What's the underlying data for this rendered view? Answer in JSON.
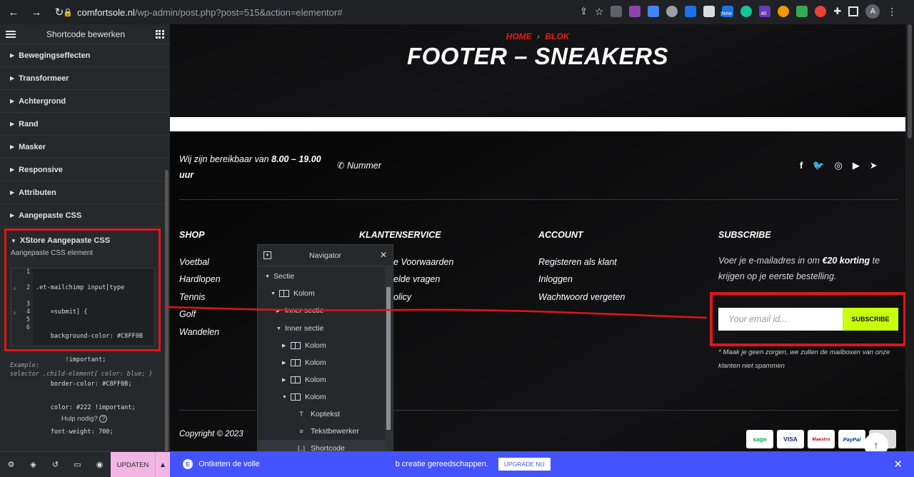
{
  "browser": {
    "host": "comfortsole.nl",
    "path": "/wp-admin/post.php?post=515&action=elementor#",
    "avatar_letter": "A",
    "ext_badges": [
      "New",
      "40"
    ]
  },
  "panel": {
    "title": "Shortcode bewerken",
    "sections": [
      "Bewegingseffecten",
      "Transformeer",
      "Achtergrond",
      "Rand",
      "Masker",
      "Responsive",
      "Attributen",
      "Aangepaste CSS"
    ],
    "xstore_title": "XStore Aangepaste CSS",
    "css_label": "Aangepaste CSS element",
    "code_lines": [
      ".et-mailchimp input[type",
      "    =submit] {",
      "    background-color: #C8FF0B",
      "        !important;",
      "    border-color: #C8FF0B;",
      "    color: #222 !important;",
      "    font-weight: 700;",
      "}"
    ],
    "line_numbers": [
      "1",
      "2",
      "",
      "3",
      "4",
      "5",
      "6"
    ],
    "example_1": "Example:",
    "example_2": "selector .child-element{ color: blue; }",
    "help": "Hulp nodig?",
    "update_label": "UPDATEN"
  },
  "site": {
    "crumb_home": "HOME",
    "crumb_sep": "›",
    "crumb_blog": "BLOK",
    "page_title": "FOOTER – SNEAKERS",
    "hours_prefix": "Wij zijn bereikbaar van",
    "hours_bold": "8.00 – 19.00 uur",
    "phone": "Nummer",
    "shop_head": "SHOP",
    "shop_links": [
      "Voetbal",
      "Hardlopen",
      "Tennis",
      "Golf",
      "Wandelen"
    ],
    "service_head": "KLANTENSERVICE",
    "service_links": [
      "e Voorwaarden",
      "elde vragen",
      "olicy"
    ],
    "account_head": "ACCOUNT",
    "account_links": [
      "Registeren als klant",
      "Inloggen",
      "Wachtwoord vergeten"
    ],
    "subscribe_head": "SUBSCRIBE",
    "subscribe_text_1": "Voer je e-mailadres in om",
    "subscribe_bold": "€20 korting",
    "subscribe_text_2": "te krijgen op je eerste bestelling.",
    "email_placeholder": "Your email id...",
    "subscribe_button": "SUBSCRIBE",
    "subscribe_note": "* Maak je geen zorgen, we zullen de mailboxen van onze klanten niet spammen",
    "copyright": "Copyright © 2023",
    "payments": [
      "sage",
      "VISA",
      "Maestro",
      "PayPal"
    ],
    "accent": "#C8FF0B",
    "crumb_color": "#E2231A"
  },
  "navigator": {
    "title": "Navigator",
    "items": [
      "Sectie",
      "Kolom",
      "Inner sectie",
      "Inner sectie",
      "Kolom",
      "Kolom",
      "Kolom",
      "Kolom",
      "Koptekst",
      "Tekstbewerker",
      "Shortcode"
    ]
  },
  "banner": {
    "text": "Ontketen de volle",
    "text_tail": "b creatie gereedschappen.",
    "upgrade": "UPGRADE NU"
  }
}
